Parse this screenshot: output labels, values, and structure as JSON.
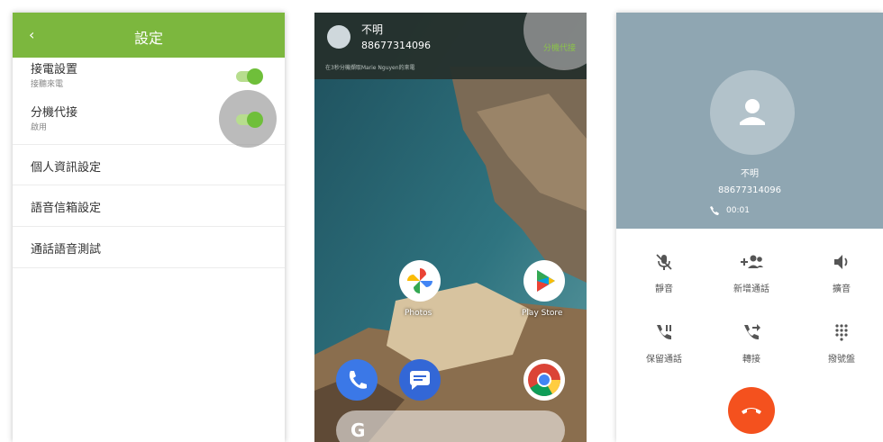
{
  "settings": {
    "title": "設定",
    "back_icon": "chevron-left-icon",
    "rows": [
      {
        "label": "接電設置",
        "sublabel": "接聽來電",
        "toggle_on": true
      },
      {
        "label": "分機代接",
        "sublabel": "啟用",
        "toggle_on": true
      }
    ],
    "items": [
      "個人資訊設定",
      "語音信箱設定",
      "通話語音測試"
    ],
    "accent_color": "#7cb73e"
  },
  "homescreen": {
    "notification": {
      "caller": "不明",
      "number": "88677314096",
      "action": "分機代接",
      "detail": "在3秒分機擷取Marie Nguyen的來電"
    },
    "apps": [
      {
        "name": "Photos",
        "icon": "photos-icon"
      },
      {
        "name": "Play Store",
        "icon": "play-store-icon"
      }
    ],
    "dock": [
      "phone-icon",
      "messages-icon",
      "chrome-icon"
    ],
    "search_glyph": "G"
  },
  "call": {
    "caller": "不明",
    "number": "88677314096",
    "timer": "00:01",
    "buttons": [
      {
        "label": "靜音",
        "icon": "mute-icon"
      },
      {
        "label": "新增通話",
        "icon": "add-call-icon"
      },
      {
        "label": "擴音",
        "icon": "speaker-icon"
      },
      {
        "label": "保留通話",
        "icon": "hold-icon"
      },
      {
        "label": "轉接",
        "icon": "transfer-icon"
      },
      {
        "label": "撥號盤",
        "icon": "dialpad-icon"
      }
    ],
    "hangup_color": "#f4511e"
  }
}
